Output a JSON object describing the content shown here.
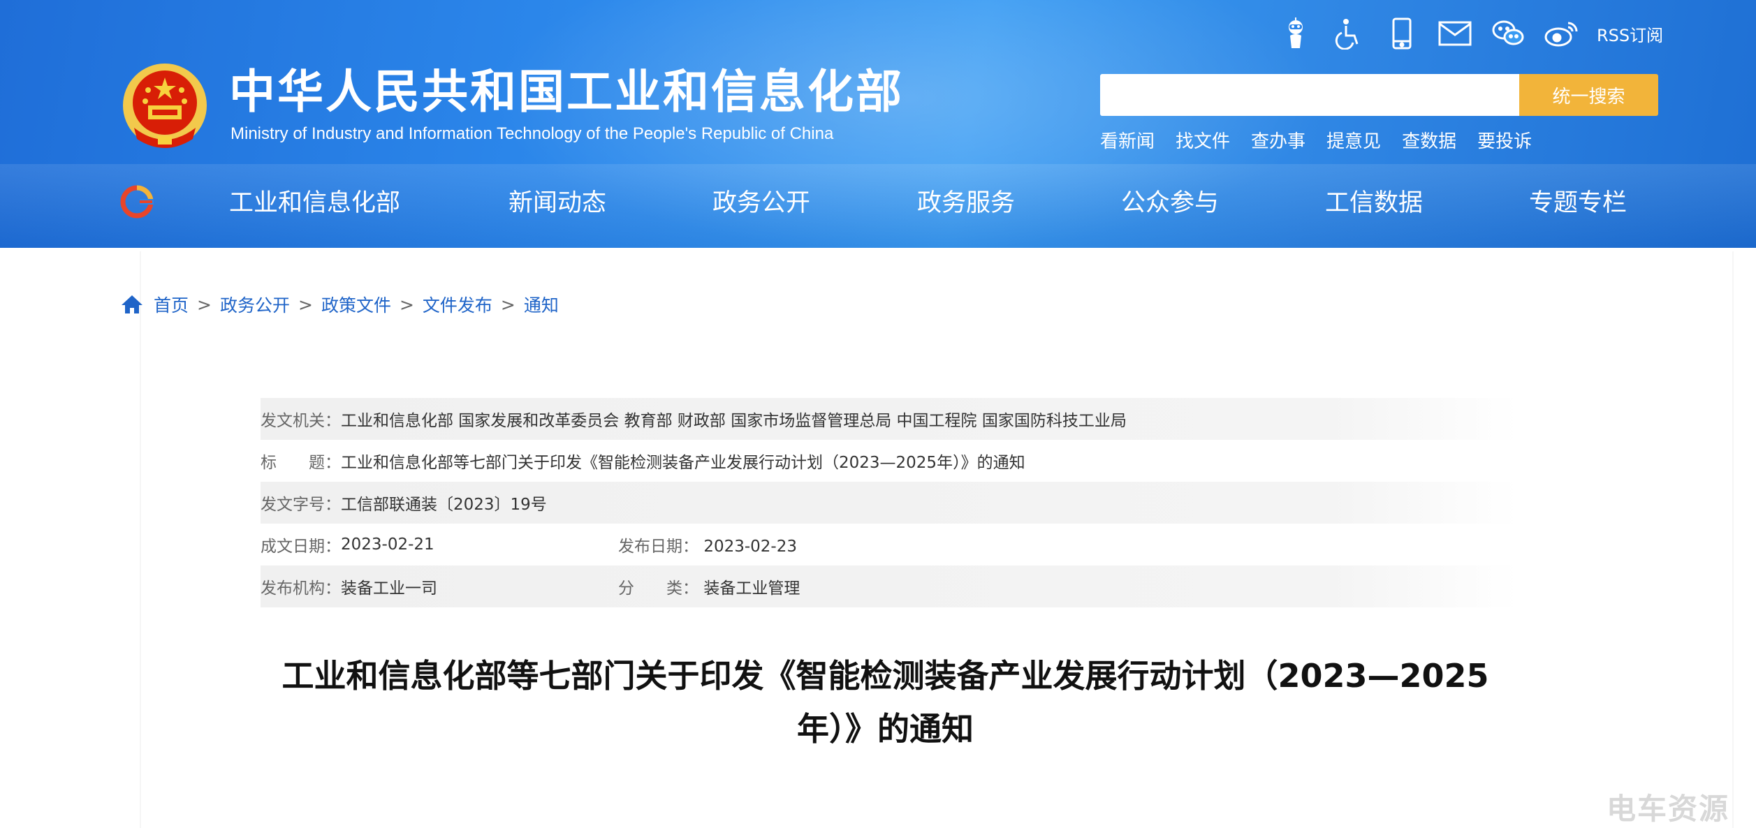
{
  "header": {
    "site_title_cn": "中华人民共和国工业和信息化部",
    "site_title_en": "Ministry of Industry and Information Technology of the People's Republic of China",
    "toolbar": {
      "rss_label": "RSS订阅"
    },
    "search": {
      "placeholder": "",
      "button_label": "统一搜索"
    },
    "quick_links": [
      "看新闻",
      "找文件",
      "查办事",
      "提意见",
      "查数据",
      "要投诉"
    ]
  },
  "nav": {
    "items": [
      "工业和信息化部",
      "新闻动态",
      "政务公开",
      "政务服务",
      "公众参与",
      "工信数据",
      "专题专栏"
    ]
  },
  "breadcrumb": [
    "首页",
    "政务公开",
    "政策文件",
    "文件发布",
    "通知"
  ],
  "breadcrumb_sep": ">",
  "meta": {
    "issuer_label": "发文机关：",
    "issuer_value": "工业和信息化部 国家发展和改革委员会 教育部 财政部 国家市场监督管理总局 中国工程院 国家国防科技工业局",
    "title_label": "标　　题：",
    "title_value": "工业和信息化部等七部门关于印发《智能检测装备产业发展行动计划（2023—2025年）》的通知",
    "docno_label": "发文字号：",
    "docno_value": "工信部联通装〔2023〕19号",
    "created_label": "成文日期：",
    "created_value": "2023-02-21",
    "published_label": "发布日期：",
    "published_value": "2023-02-23",
    "agency_label": "发布机构：",
    "agency_value": "装备工业一司",
    "category_label": "分　　类：",
    "category_value": "装备工业管理"
  },
  "document": {
    "title_line1": "工业和信息化部等七部门关于印发《智能检测装备产业发展行动计划（2023—2025",
    "title_line2": "年）》的通知"
  },
  "watermark": "电车资源",
  "colors": {
    "header_blue": "#2b86ea",
    "search_button": "#f2b43a",
    "link_blue": "#1f64c8"
  }
}
